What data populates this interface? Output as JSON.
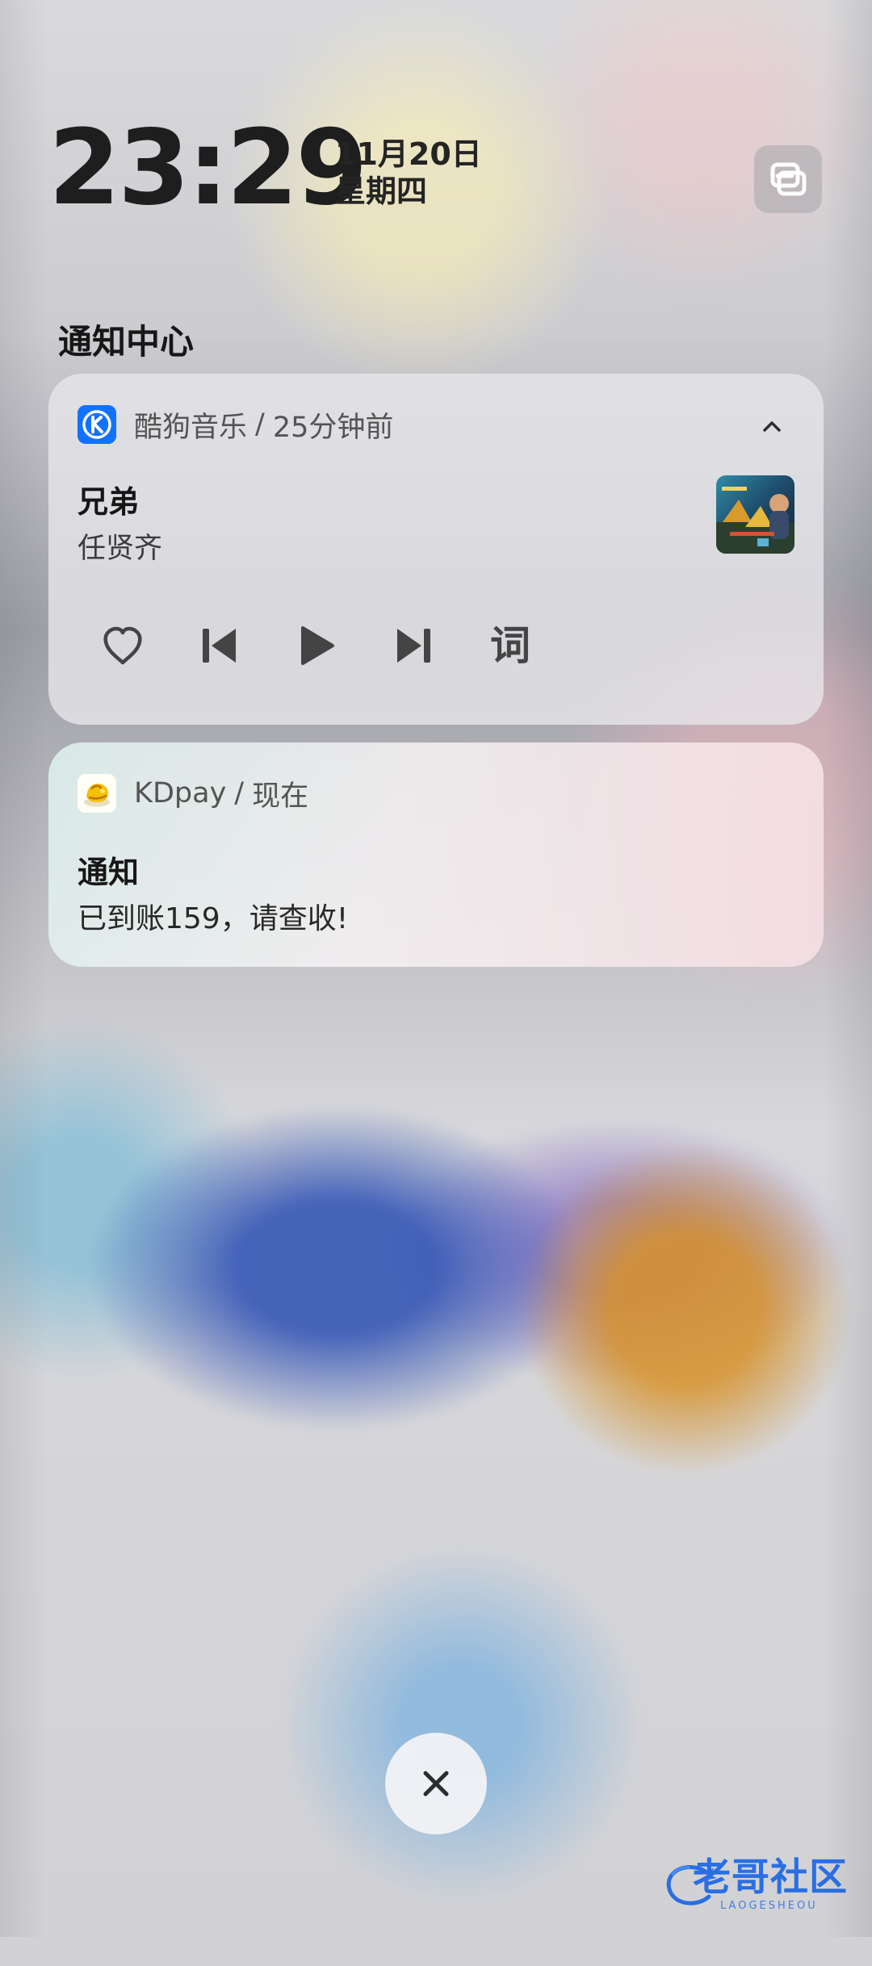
{
  "lockscreen": {
    "time": "23:29",
    "date": "11月20日",
    "weekday": "星期四"
  },
  "notification_center": {
    "title": "通知中心"
  },
  "notifications": [
    {
      "app_name": "酷狗音乐",
      "separator": "/",
      "time_ago": "25分钟前",
      "app_icon": "kugou-icon",
      "content": {
        "title": "兄弟",
        "subtitle": "任贤齐"
      },
      "controls": [
        {
          "name": "favorite-icon"
        },
        {
          "name": "previous-track-icon"
        },
        {
          "name": "play-icon"
        },
        {
          "name": "next-track-icon"
        },
        {
          "name": "lyrics-button",
          "label": "词"
        }
      ]
    },
    {
      "app_name": "KDpay",
      "separator": "/",
      "time_ago": "现在",
      "app_icon": "kdpay-icon",
      "content": {
        "title": "通知",
        "body": "已到账159，请查收!"
      }
    }
  ],
  "watermark": {
    "main": "老哥社区",
    "sub": "LAOGESHEOU"
  },
  "colors": {
    "kugou_blue": "#1272ff",
    "kdpay_yellow": "#f4c000",
    "watermark_blue": "#2a6ee3"
  }
}
